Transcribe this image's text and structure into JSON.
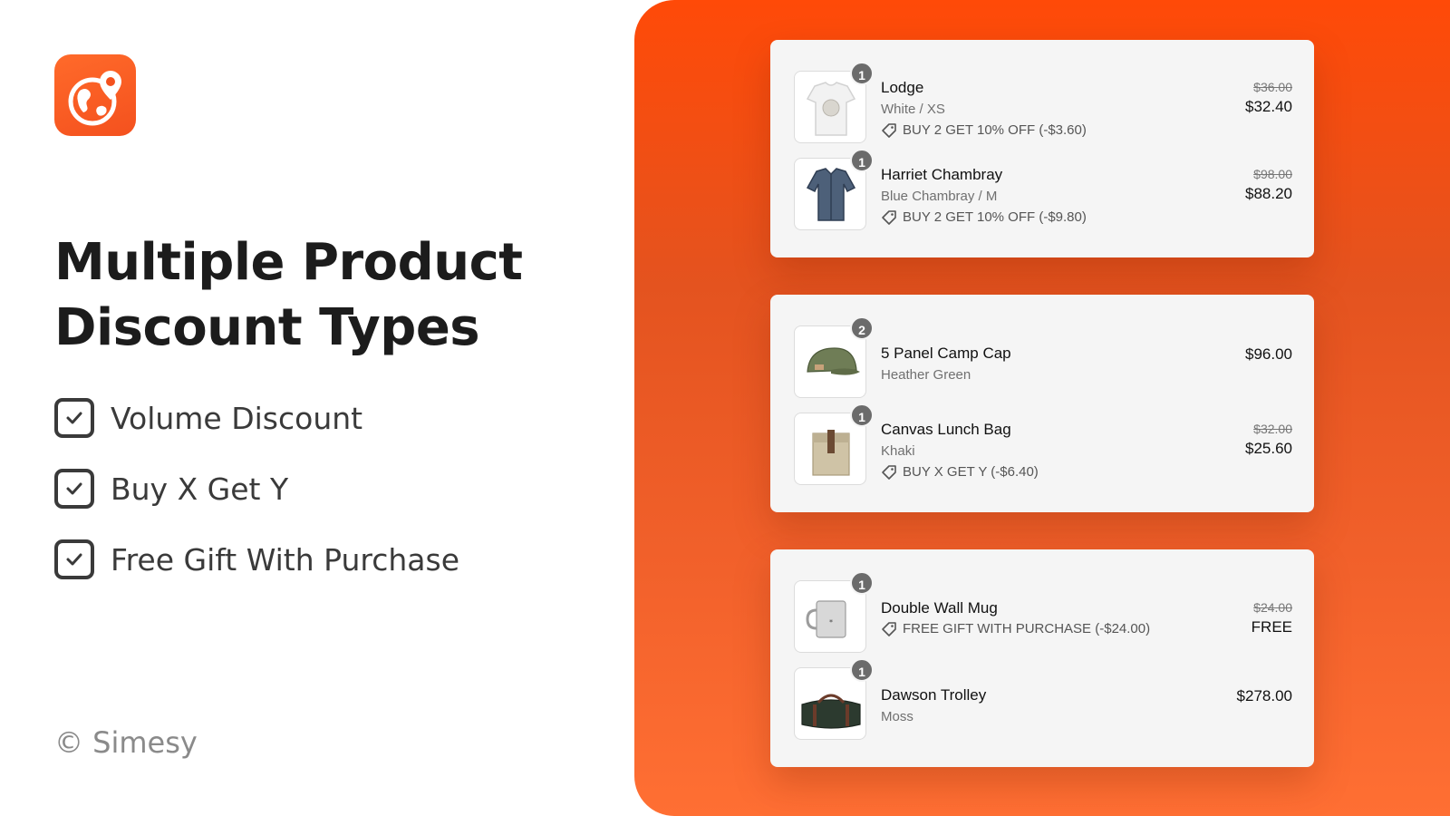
{
  "brand": {
    "logo_icon": "globe-location-icon",
    "accent": "#f4511e"
  },
  "headline": {
    "line1": "Multiple Product",
    "line2": "Discount Types"
  },
  "features": [
    {
      "label": "Volume Discount",
      "checked": true
    },
    {
      "label": "Buy X Get Y",
      "checked": true
    },
    {
      "label": "Free Gift With Purchase",
      "checked": true
    }
  ],
  "copyright": "© Simesy",
  "cards": [
    {
      "items": [
        {
          "qty": "1",
          "name": "Lodge",
          "variant": "White / XS",
          "discount": "BUY 2 GET 10% OFF (-$3.60)",
          "old_price": "$36.00",
          "price": "$32.40",
          "image": "tshirt"
        },
        {
          "qty": "1",
          "name": "Harriet Chambray",
          "variant": "Blue Chambray / M",
          "discount": "BUY 2 GET 10% OFF (-$9.80)",
          "old_price": "$98.00",
          "price": "$88.20",
          "image": "shirt"
        }
      ]
    },
    {
      "items": [
        {
          "qty": "2",
          "name": "5 Panel Camp Cap",
          "variant": "Heather Green",
          "price": "$96.00",
          "image": "cap"
        },
        {
          "qty": "1",
          "name": "Canvas Lunch Bag",
          "variant": "Khaki",
          "discount": "BUY X GET Y (-$6.40)",
          "old_price": "$32.00",
          "price": "$25.60",
          "image": "lunch-bag"
        }
      ]
    },
    {
      "items": [
        {
          "qty": "1",
          "name": "Double Wall Mug",
          "discount": "FREE GIFT WITH PURCHASE (-$24.00)",
          "old_price": "$24.00",
          "price": "FREE",
          "image": "mug"
        },
        {
          "qty": "1",
          "name": "Dawson Trolley",
          "variant": "Moss",
          "price": "$278.00",
          "image": "duffel-bag"
        }
      ]
    }
  ]
}
